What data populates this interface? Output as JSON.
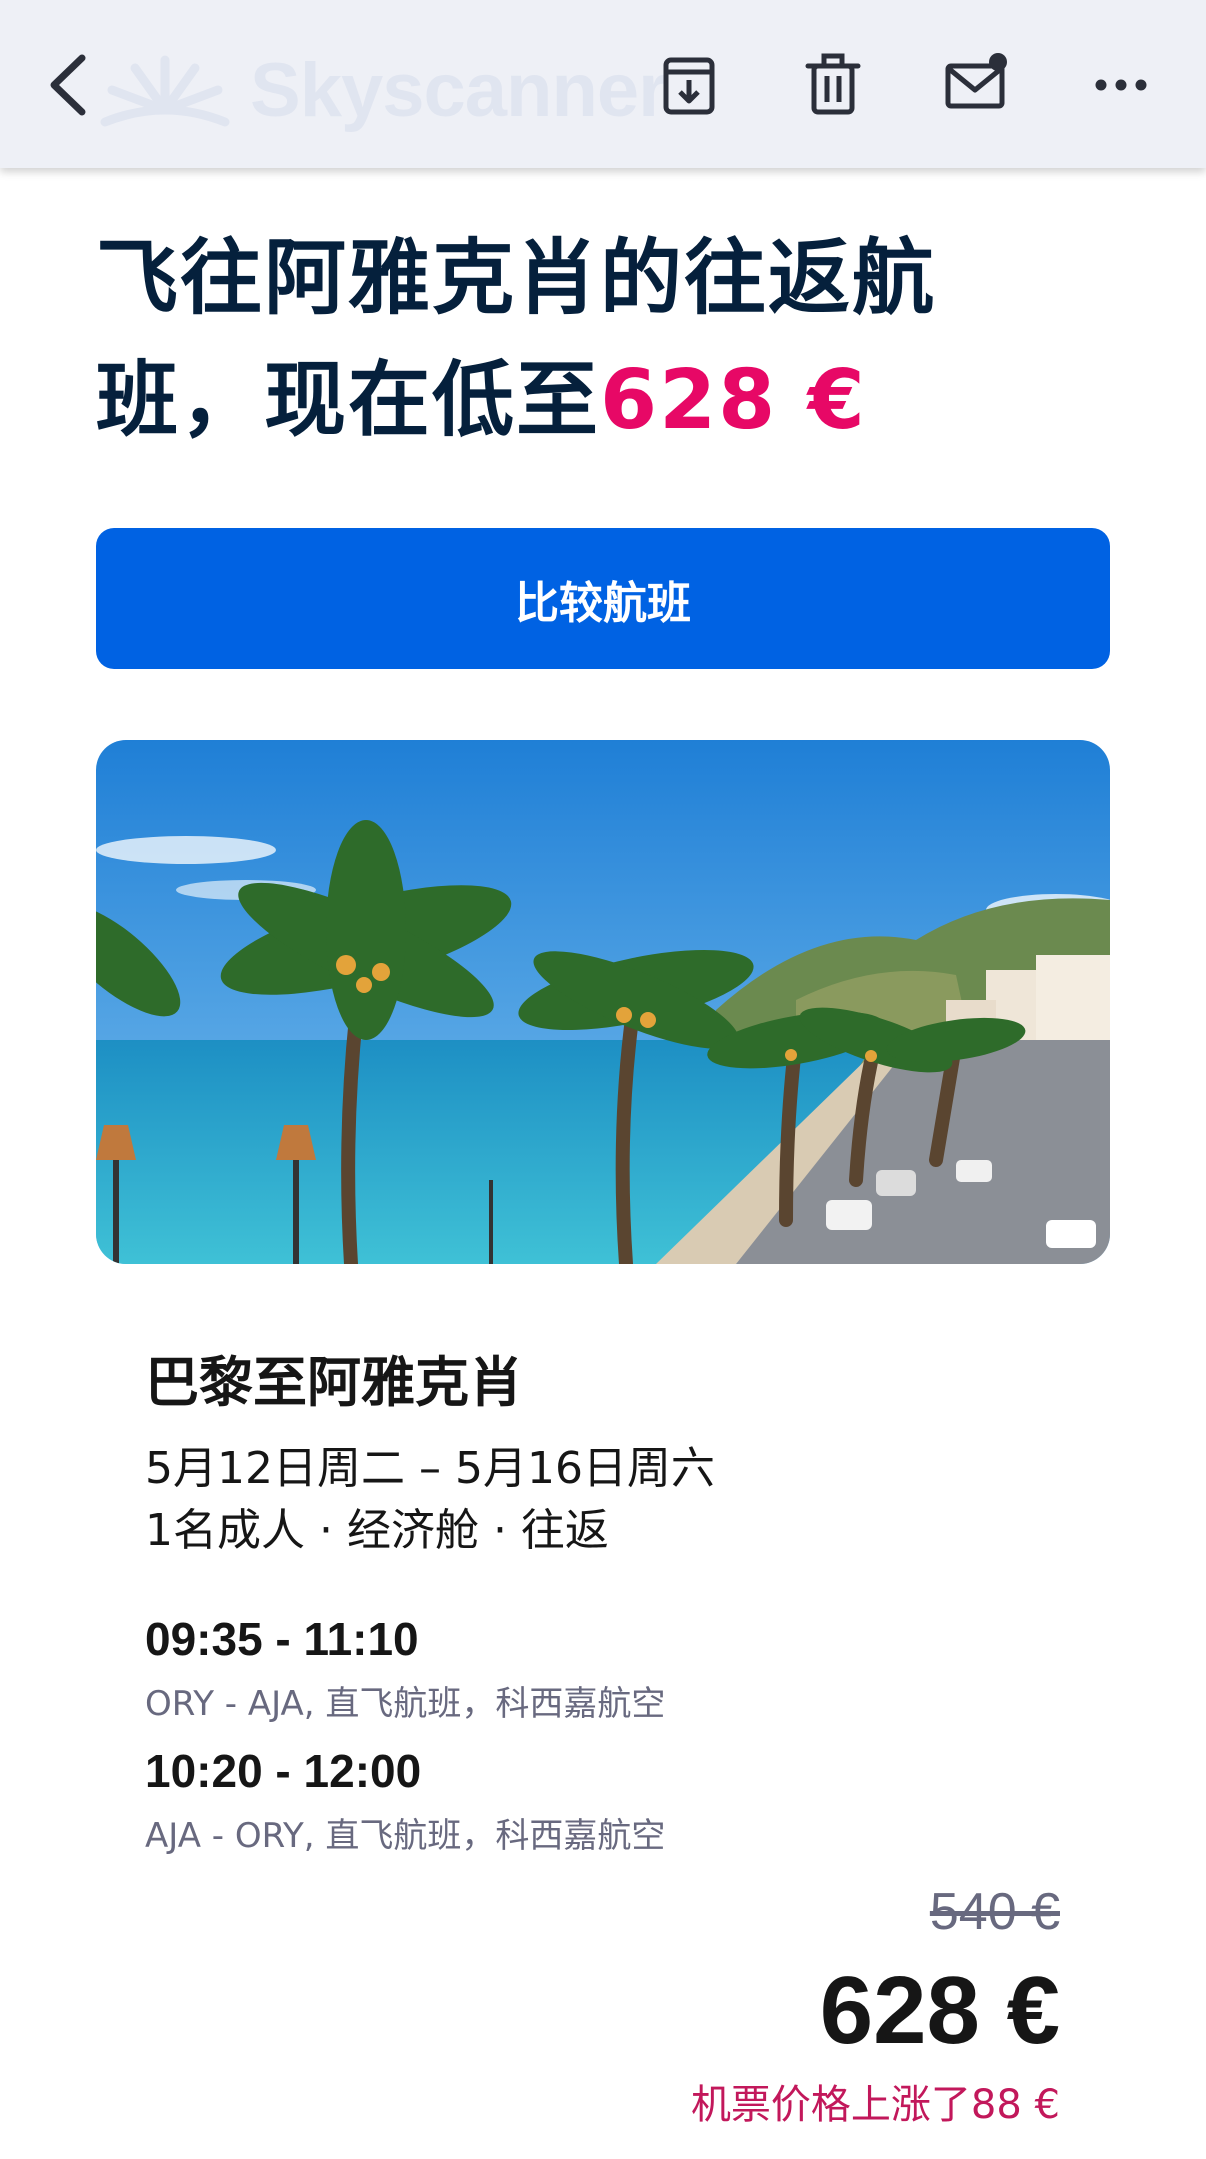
{
  "toolbar": {
    "brand": "Skyscanner",
    "icons": [
      "back-icon",
      "archive-icon",
      "trash-icon",
      "mark-unread-icon",
      "more-icon"
    ]
  },
  "headline": {
    "text_line1": "飞往阿雅克肖的往返航",
    "text_line2": "班，现在低至",
    "price": "628 €"
  },
  "cta": {
    "label": "比较航班"
  },
  "hero": {
    "alt": "palm-lined seaside promenade"
  },
  "trip": {
    "route": "巴黎至阿雅克肖",
    "dates": "5月12日周二 – 5月16日周六",
    "passengers": "1名成人 · 经济舱 · 往返"
  },
  "legs": [
    {
      "time": "09:35 - 11:10",
      "info": "ORY - AJA, 直飞航班，科西嘉航空"
    },
    {
      "time": "10:20 - 12:00",
      "info": "AJA - ORY, 直飞航班，科西嘉航空"
    }
  ],
  "pricing": {
    "old_price": "540 €",
    "new_price": "628 €",
    "note": "机票价格上涨了88 €"
  },
  "colors": {
    "accent_blue": "#0062e3",
    "price_pink": "#e70866",
    "text_dark": "#05203c"
  }
}
